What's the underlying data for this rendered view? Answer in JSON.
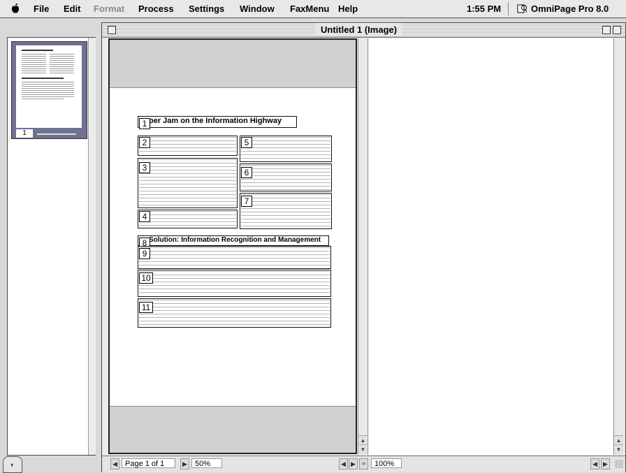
{
  "menubar": {
    "apple_icon": "apple-icon",
    "menus": [
      {
        "label": "File",
        "enabled": true
      },
      {
        "label": "Edit",
        "enabled": true
      },
      {
        "label": "Format",
        "enabled": false
      },
      {
        "label": "Process",
        "enabled": true
      },
      {
        "label": "Settings",
        "enabled": true
      },
      {
        "label": "Window",
        "enabled": true
      },
      {
        "label": "FaxMenu",
        "enabled": true
      },
      {
        "label": "Help",
        "enabled": true
      }
    ],
    "clock": "1:55 PM",
    "app_icon": "omnipage-app-icon",
    "app_name": "OmniPage Pro 8.0"
  },
  "thumbnails": [
    {
      "page_number": "1",
      "selected": true
    }
  ],
  "window": {
    "title": "Untitled 1 (Image)"
  },
  "zones": [
    {
      "number": "1",
      "text": "per Jam on the Information Highway"
    },
    {
      "number": "2",
      "text": ""
    },
    {
      "number": "3",
      "text": ""
    },
    {
      "number": "4",
      "text": ""
    },
    {
      "number": "5",
      "text": ""
    },
    {
      "number": "6",
      "text": ""
    },
    {
      "number": "7",
      "text": ""
    },
    {
      "number": "8",
      "text": "Solution: Information Recognition and Management"
    },
    {
      "number": "9",
      "text": ""
    },
    {
      "number": "10",
      "text": ""
    },
    {
      "number": "11",
      "text": ""
    }
  ],
  "status": {
    "page_label": "Page 1 of 1",
    "image_zoom": "50%",
    "text_zoom": "100%"
  },
  "colors": {
    "thumb_selection": "#6f7190",
    "menubar_bg": "#e8e8e8",
    "window_bg": "#ececec"
  }
}
